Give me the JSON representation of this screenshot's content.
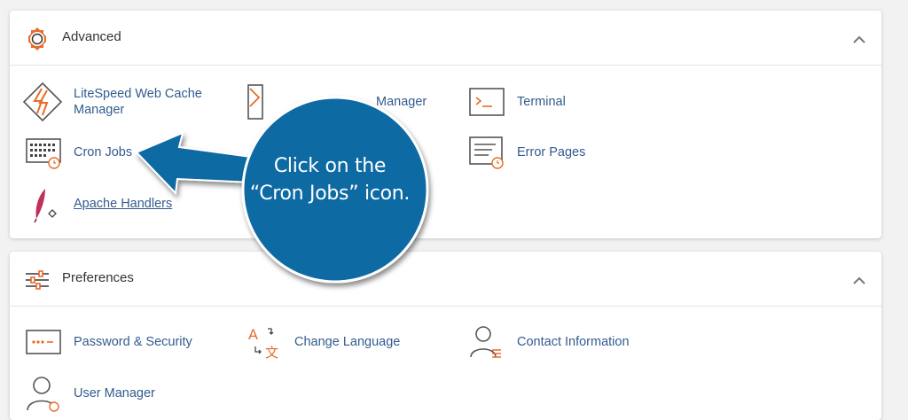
{
  "advanced": {
    "title": "Advanced",
    "items": [
      {
        "label": "LiteSpeed Web Cache Manager",
        "icon": "litespeed-icon"
      },
      {
        "label": "Manager",
        "icon": "track-dns-icon"
      },
      {
        "label": "Terminal",
        "icon": "terminal-icon"
      },
      {
        "label": "Cron Jobs",
        "icon": "calendar-clock-icon"
      },
      {
        "label": "Error Pages",
        "icon": "error-page-icon"
      },
      {
        "label": "Apache Handlers",
        "icon": "feather-icon"
      }
    ]
  },
  "preferences": {
    "title": "Preferences",
    "items": [
      {
        "label": "Password & Security",
        "icon": "password-icon"
      },
      {
        "label": "Change Language",
        "icon": "language-icon"
      },
      {
        "label": "Contact Information",
        "icon": "contact-icon"
      },
      {
        "label": "User Manager",
        "icon": "user-icon"
      }
    ]
  },
  "callout": {
    "line1": "Click on the",
    "line2": "“Cron Jobs” icon."
  },
  "colors": {
    "accent_orange": "#e86b2a",
    "link_blue": "#335b8f",
    "callout_blue": "#0d6aa3"
  }
}
